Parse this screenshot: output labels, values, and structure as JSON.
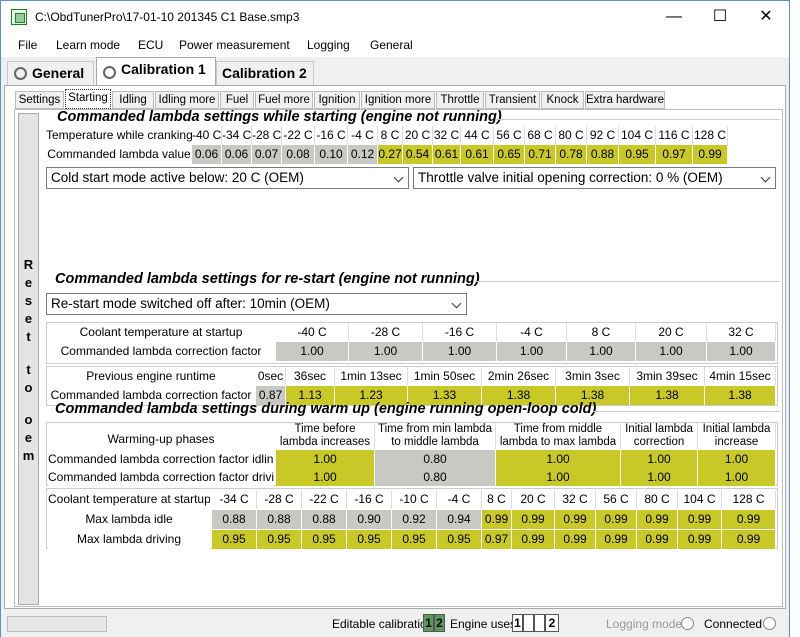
{
  "window": {
    "title": "C:\\ObdTunerPro\\17-01-10 201345 C1 Base.smp3"
  },
  "menu": [
    "File",
    "Learn mode",
    "ECU",
    "Power measurement",
    "Logging",
    "General"
  ],
  "main_tabs": [
    "General",
    "Calibration 1",
    "Calibration 2"
  ],
  "sub_tabs": [
    "Settings",
    "Starting",
    "Idling",
    "Idling more",
    "Fuel",
    "Fuel more",
    "Ignition",
    "Ignition more",
    "Throttle",
    "Transient",
    "Knock",
    "Extra hardware"
  ],
  "reset_button": [
    "R",
    "e",
    "s",
    "e",
    "t",
    "t",
    "o",
    "o",
    "e",
    "m"
  ],
  "section1": {
    "title": "Commanded lambda settings while starting (engine not running)",
    "row_header_label": "Temperature while cranking",
    "row_value_label": "Commanded lambda value",
    "temps": [
      "-40 C",
      "-34 C",
      "-28 C",
      "-22 C",
      "-16 C",
      "-4 C",
      "8 C",
      "20 C",
      "32 C",
      "44 C",
      "56 C",
      "68 C",
      "80 C",
      "92 C",
      "104 C",
      "116 C",
      "128 C"
    ],
    "values": [
      "0.06",
      "0.06",
      "0.07",
      "0.08",
      "0.10",
      "0.12",
      "0.27",
      "0.54",
      "0.61",
      "0.61",
      "0.65",
      "0.71",
      "0.78",
      "0.88",
      "0.95",
      "0.97",
      "0.99"
    ],
    "cold_start_combo": "Cold start mode active below: 20 C (OEM)",
    "throttle_combo": "Throttle valve initial opening correction:    0 % (OEM)"
  },
  "section2": {
    "title": "Commanded lambda settings for re-start (engine not running)",
    "restart_combo": "Re-start mode switched off after: 10min (OEM)",
    "coolant_label": "Coolant temperature at startup",
    "coolant_corr_label": "Commanded lambda correction factor",
    "coolant_temps": [
      "-40 C",
      "-28 C",
      "-16 C",
      "-4 C",
      "8 C",
      "20 C",
      "32 C"
    ],
    "coolant_values": [
      "1.00",
      "1.00",
      "1.00",
      "1.00",
      "1.00",
      "1.00",
      "1.00"
    ],
    "runtime_label": "Previous engine runtime",
    "runtime_corr_label": "Commanded lambda correction factor",
    "runtimes": [
      "0sec",
      "36sec",
      "1min 13sec",
      "1min 50sec",
      "2min 26sec",
      "3min 3sec",
      "3min 39sec",
      "4min 15sec"
    ],
    "runtime_values": [
      "0.87",
      "1.13",
      "1.23",
      "1.33",
      "1.38",
      "1.38",
      "1.38",
      "1.38"
    ]
  },
  "section3": {
    "title": "Commanded lambda settings during warm up (engine running open-loop cold)",
    "phases_label": "Warming-up phases",
    "phase_headers": [
      [
        "Time before",
        "lambda increases"
      ],
      [
        "Time from min lambda",
        "to middle lambda"
      ],
      [
        "Time from middle",
        "lambda to max lambda"
      ],
      [
        "Initial lambda",
        "correction"
      ],
      [
        "Initial lambda",
        "increase"
      ]
    ],
    "idling_label": "Commanded lambda correction factor idling",
    "driving_label": "Commanded lambda correction factor driving",
    "idling_values": [
      "1.00",
      "0.80",
      "1.00",
      "1.00",
      "1.00"
    ],
    "driving_values": [
      "1.00",
      "0.80",
      "1.00",
      "1.00",
      "1.00"
    ],
    "coolant_label": "Coolant temperature at startup",
    "temps": [
      "-34 C",
      "-28 C",
      "-22 C",
      "-16 C",
      "-10 C",
      "-4 C",
      "8 C",
      "20 C",
      "32 C",
      "56 C",
      "80 C",
      "104 C",
      "128 C"
    ],
    "max_idle_label": "Max lambda idle",
    "max_driving_label": "Max lambda driving",
    "max_idle": [
      "0.88",
      "0.88",
      "0.88",
      "0.90",
      "0.92",
      "0.94",
      "0.99",
      "0.99",
      "0.99",
      "0.99",
      "0.99",
      "0.99",
      "0.99"
    ],
    "max_driving": [
      "0.95",
      "0.95",
      "0.95",
      "0.95",
      "0.95",
      "0.95",
      "0.97",
      "0.99",
      "0.99",
      "0.99",
      "0.99",
      "0.99",
      "0.99"
    ]
  },
  "status": {
    "editable_label": "Editable calibration",
    "editable_slots": [
      "1",
      "2"
    ],
    "engine_label": "Engine uses",
    "engine_slots": [
      "1",
      "",
      "",
      "2"
    ],
    "logging_mode": "Logging mode",
    "connected": "Connected"
  },
  "colors": {
    "yellow": "#c8c826",
    "gray": "#c8c8c4",
    "active_slot": "#5a9a5a"
  }
}
